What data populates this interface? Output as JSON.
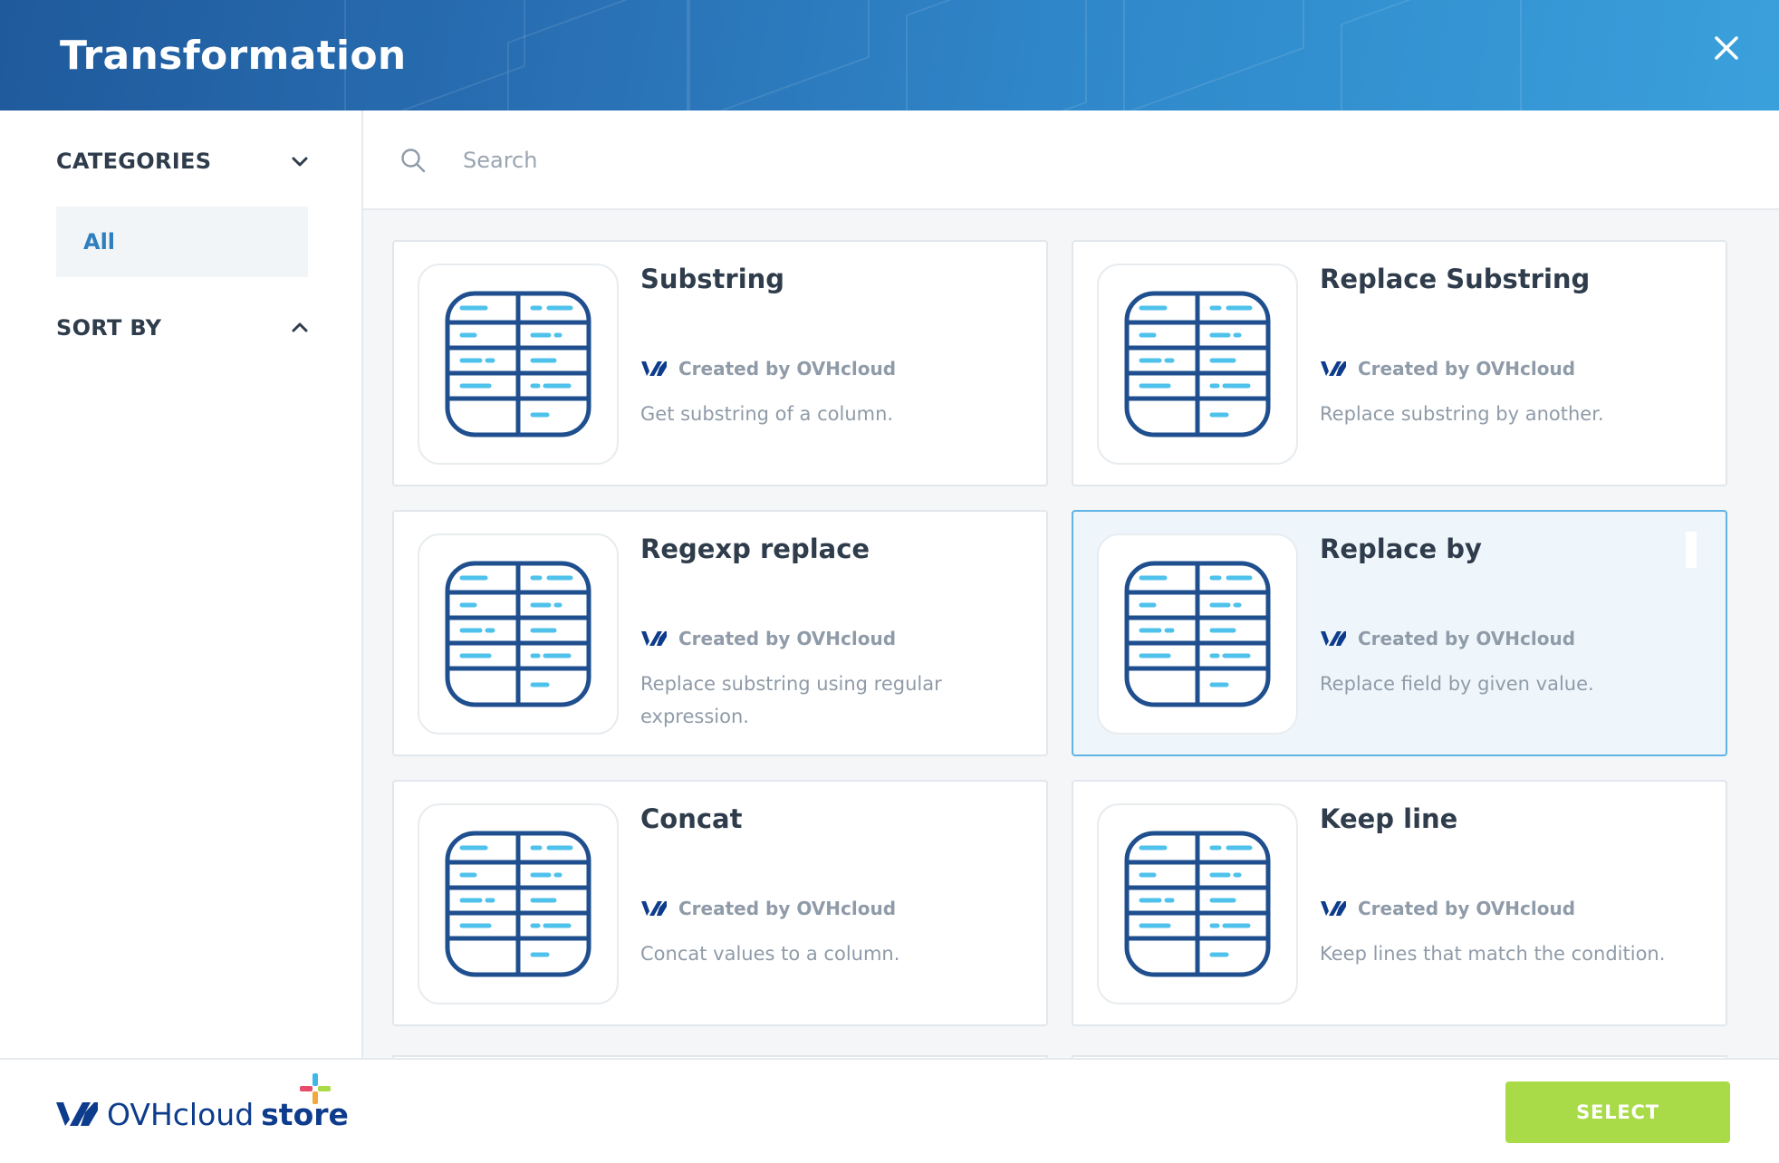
{
  "modal": {
    "title": "Transformation",
    "close_label": "close"
  },
  "sidebar": {
    "categories_label": "CATEGORIES",
    "categories_state": "expanded",
    "category_items": [
      {
        "label": "All",
        "active": true
      }
    ],
    "sort_label": "SORT BY",
    "sort_state": "collapsed"
  },
  "search": {
    "placeholder": "Search",
    "value": ""
  },
  "cards": [
    {
      "title": "Substring",
      "author": "Created by OVHcloud",
      "description": "Get substring of a column.",
      "icon": "table-icon",
      "selected": false
    },
    {
      "title": "Replace Substring",
      "author": "Created by OVHcloud",
      "description": "Replace substring by another.",
      "icon": "table-icon",
      "selected": false
    },
    {
      "title": "Regexp replace",
      "author": "Created by OVHcloud",
      "description": "Replace substring using regular expression.",
      "icon": "table-icon",
      "selected": false
    },
    {
      "title": "Replace by",
      "author": "Created by OVHcloud",
      "description": "Replace field by given value.",
      "icon": "table-icon",
      "selected": true
    },
    {
      "title": "Concat",
      "author": "Created by OVHcloud",
      "description": "Concat values to a column.",
      "icon": "table-icon",
      "selected": false
    },
    {
      "title": "Keep line",
      "author": "Created by OVHcloud",
      "description": "Keep lines that match the condition.",
      "icon": "table-icon",
      "selected": false
    }
  ],
  "footer": {
    "brand": "OVHcloud",
    "brand_suffix": "store",
    "select_label": "SELECT"
  },
  "colors": {
    "accent": "#2e7fc0",
    "select_button": "#a9da48",
    "selected_card_border": "#5fb4e6",
    "brand_navy": "#0e3c8c"
  }
}
